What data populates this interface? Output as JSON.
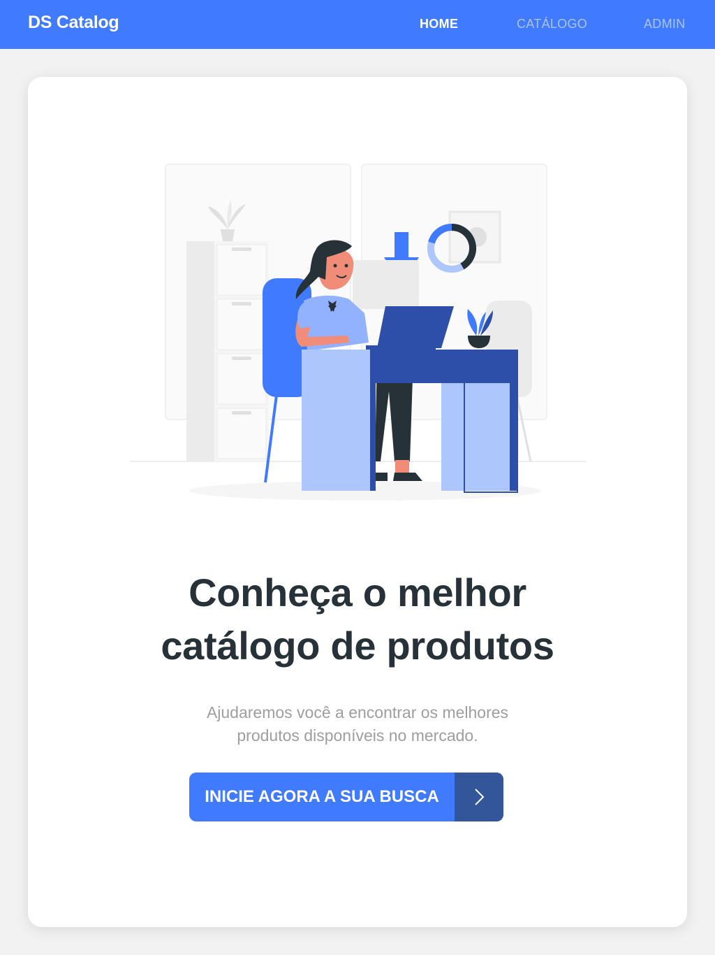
{
  "navbar": {
    "brand": "DS Catalog",
    "links": [
      {
        "label": "HOME",
        "active": true
      },
      {
        "label": "CATÁLOGO",
        "active": false
      },
      {
        "label": "ADMIN",
        "active": false
      }
    ]
  },
  "hero": {
    "title_line1": "Conheça o melhor",
    "title_line2": "catálogo de produtos",
    "subtitle_line1": "Ajudaremos você a encontrar os melhores",
    "subtitle_line2": "produtos disponíveis no mercado.",
    "cta_label": "INICIE AGORA A SUA BUSCA",
    "cta_icon": "chevron-right-icon"
  },
  "illustration": {
    "name": "woman-working-at-desk-illustration",
    "colors": {
      "primary": "#407bff",
      "dark": "#2d4faa",
      "light": "#adc6fc",
      "gray": "#ebebeb",
      "skin": "#f08c77",
      "hair": "#263238"
    }
  },
  "theme": {
    "accent": "#407bff",
    "accent_dark": "#33569b",
    "text": "#263238",
    "muted": "#9e9e9e",
    "background": "#f2f2f2"
  }
}
